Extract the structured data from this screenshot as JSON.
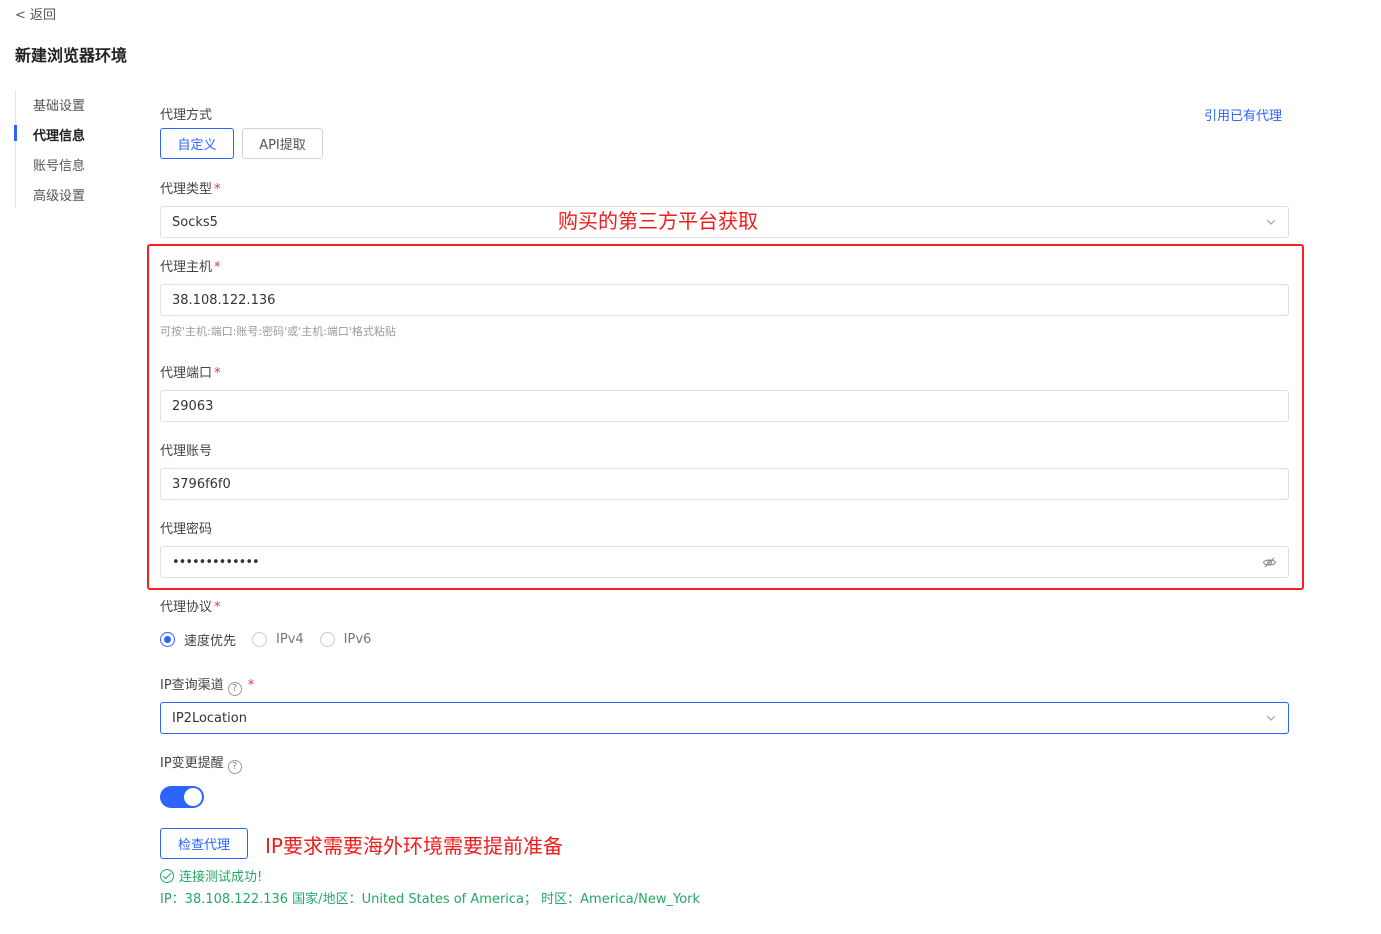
{
  "header": {
    "back_label": "< 返回",
    "title": "新建浏览器环境"
  },
  "sidebar": {
    "items": [
      {
        "label": "基础设置",
        "active": false
      },
      {
        "label": "代理信息",
        "active": true
      },
      {
        "label": "账号信息",
        "active": false
      },
      {
        "label": "高级设置",
        "active": false
      }
    ]
  },
  "proxy": {
    "method_label": "代理方式",
    "method_options": [
      "自定义",
      "API提取"
    ],
    "method_selected": "自定义",
    "use_existing_link": "引用已有代理",
    "type_label": "代理类型",
    "type_value": "Socks5",
    "host_label": "代理主机",
    "host_value": "38.108.122.136",
    "host_hint": "可按'主机:端口:账号:密码'或'主机:端口'格式粘贴",
    "port_label": "代理端口",
    "port_value": "29063",
    "account_label": "代理账号",
    "account_value": "3796f6f0",
    "password_label": "代理密码",
    "password_value": "•••••••••••••",
    "protocol_label": "代理协议",
    "protocol_options": [
      "速度优先",
      "IPv4",
      "IPv6"
    ],
    "protocol_selected": "速度优先",
    "ip_channel_label": "IP查询渠道",
    "ip_channel_value": "IP2Location",
    "ip_change_label": "IP变更提醒",
    "ip_change_enabled": true,
    "check_button": "检查代理",
    "success_text": "连接测试成功!",
    "ip_info": "IP：38.108.122.136 国家/地区：United States of America； 时区：America/New_York"
  },
  "annotations": {
    "top": "购买的第三方平台获取",
    "bottom": "IP要求需要海外环境需要提前准备"
  },
  "colors": {
    "accent": "#2b64ff",
    "annotation": "#f21c1c",
    "success": "#23a866"
  },
  "required_mark": "*",
  "help_glyph": "?"
}
